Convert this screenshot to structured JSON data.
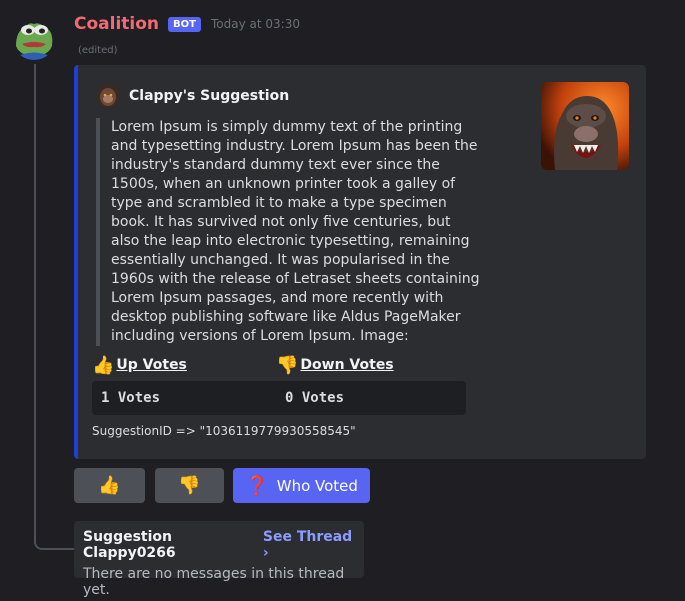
{
  "message": {
    "username": "Coalition",
    "bot_tag": "BOT",
    "timestamp": "Today at 03:30",
    "edited": "(edited)",
    "avatar_icon": "frog-avatar-icon"
  },
  "embed": {
    "accent_color": "#1f3fd6",
    "author": "Clappy's Suggestion",
    "author_icon": "gorilla-icon",
    "thumbnail_icon": "gorilla-thumbnail",
    "description": "Lorem Ipsum is simply dummy text of the printing and typesetting industry. Lorem Ipsum has been the industry's standard dummy text ever since the 1500s, when an unknown printer took a galley of type and scrambled it to make a type specimen book. It has survived not only five centuries, but also the leap into electronic typesetting, remaining essentially unchanged. It was popularised in the 1960s with the release of Letraset sheets containing Lorem Ipsum passages, and more recently with desktop publishing software like Aldus PageMaker including versions of Lorem Ipsum. Image:",
    "fields": {
      "up": {
        "emoji": "👍",
        "label": "Up Votes",
        "value": "1 Votes"
      },
      "down": {
        "emoji": "👎",
        "label": "Down Votes",
        "value": "0 Votes"
      }
    },
    "footer": "SuggestionID => \"1036119779930558545\""
  },
  "buttons": {
    "upvote_emoji": "👍",
    "downvote_emoji": "👎",
    "who_voted_icon": "❓",
    "who_voted_label": "Who Voted"
  },
  "thread": {
    "name": "Suggestion Clappy0266",
    "link": "See Thread ›",
    "empty_text": "There are no messages in this thread yet."
  }
}
